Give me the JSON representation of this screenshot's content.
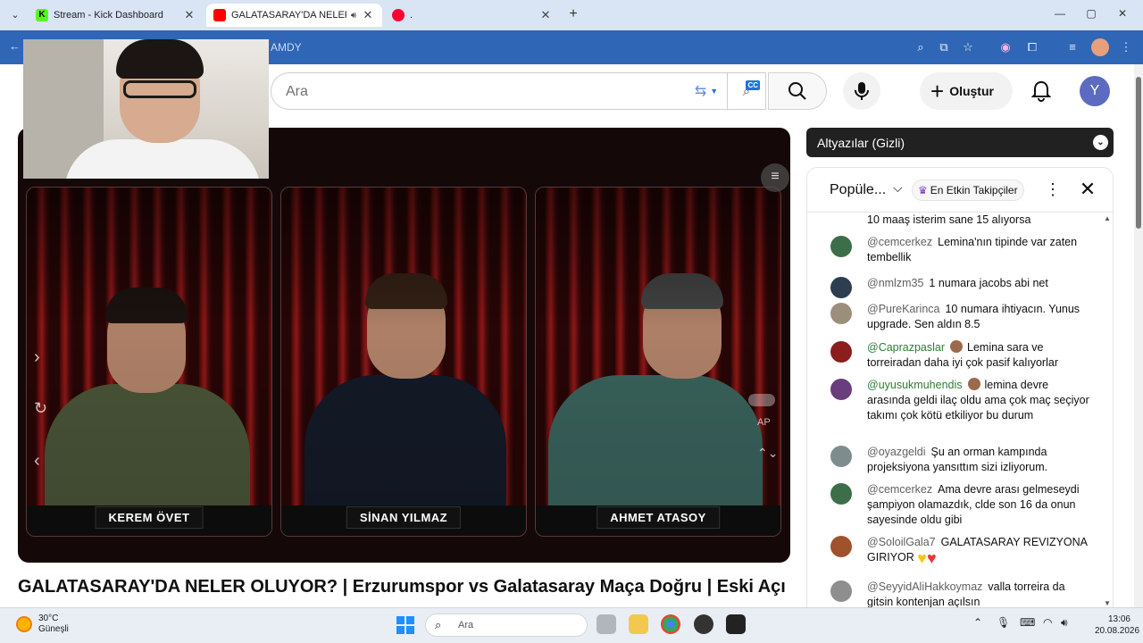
{
  "browser": {
    "tabs": [
      {
        "title": "Stream - Kick Dashboard",
        "favicon_color": "#53fc18"
      },
      {
        "title": "GALATASARAY'DA NELER O",
        "favicon_color": "#ff0000"
      },
      {
        "title": ".",
        "favicon_color": "#ff0033"
      }
    ],
    "address_text": "AMDY"
  },
  "youtube": {
    "search": {
      "placeholder": "Ara",
      "value": ""
    },
    "create_label": "Oluştur",
    "avatar_letter": "Y"
  },
  "player": {
    "hosts": [
      "KEREM ÖVET",
      "SİNAN YILMAZ",
      "AHMET ATASOY"
    ],
    "ap_label": "AP"
  },
  "video": {
    "title": "GALATASARAY'DA NELER OLUYOR? | Erzurumspor vs Galatasaray Maça Doğru | Eski Açık"
  },
  "subtitles": {
    "label": "Altyazılar (Gizli)"
  },
  "chat": {
    "mode": "Popüle...",
    "filter_chip": "En Etkin Takipçiler",
    "messages": [
      {
        "author": "",
        "text": "10 maaş isterim sane 15 alıyorsa"
      },
      {
        "author": "@cemcerkez",
        "text": "Lemina'nın tipinde var zaten tembellik"
      },
      {
        "author": "@nmlzm35",
        "text": "1 numara jacobs abi net"
      },
      {
        "author": "@PureKarinca",
        "text": "10 numara ihtiyacın. Yunus upgrade. Sen aldın 8.5"
      },
      {
        "author": "@Caprazpaslar",
        "text": "Lemina sara ve torreiradan daha iyi çok pasif kalıyorlar"
      },
      {
        "author": "@uyusukmuhendis",
        "text": "lemina devre arasında geldi ilaç oldu ama çok maç seçiyor takımı çok kötü etkiliyor bu durum"
      },
      {
        "author": "@oyazgeldi",
        "text": "Şu an orman kampında projeksiyona yansıttım sizi izliyorum."
      },
      {
        "author": "@cemcerkez",
        "text": "Ama devre arası gelmeseydi şampiyon olamazdık, clde son 16 da onun sayesinde oldu gibi"
      },
      {
        "author": "@SoloilGala7",
        "text": "GALATASARAY REVIZYONA GIRIYOR"
      },
      {
        "author": "@SeyyidAliHakkoymaz",
        "text": "valla torreira da gitsin kontenjan açılsın"
      }
    ]
  },
  "taskbar": {
    "temperature": "30°C",
    "condition": "Güneşli",
    "search_placeholder": "Ara",
    "time": "13:06",
    "date": "20.08.2026"
  }
}
